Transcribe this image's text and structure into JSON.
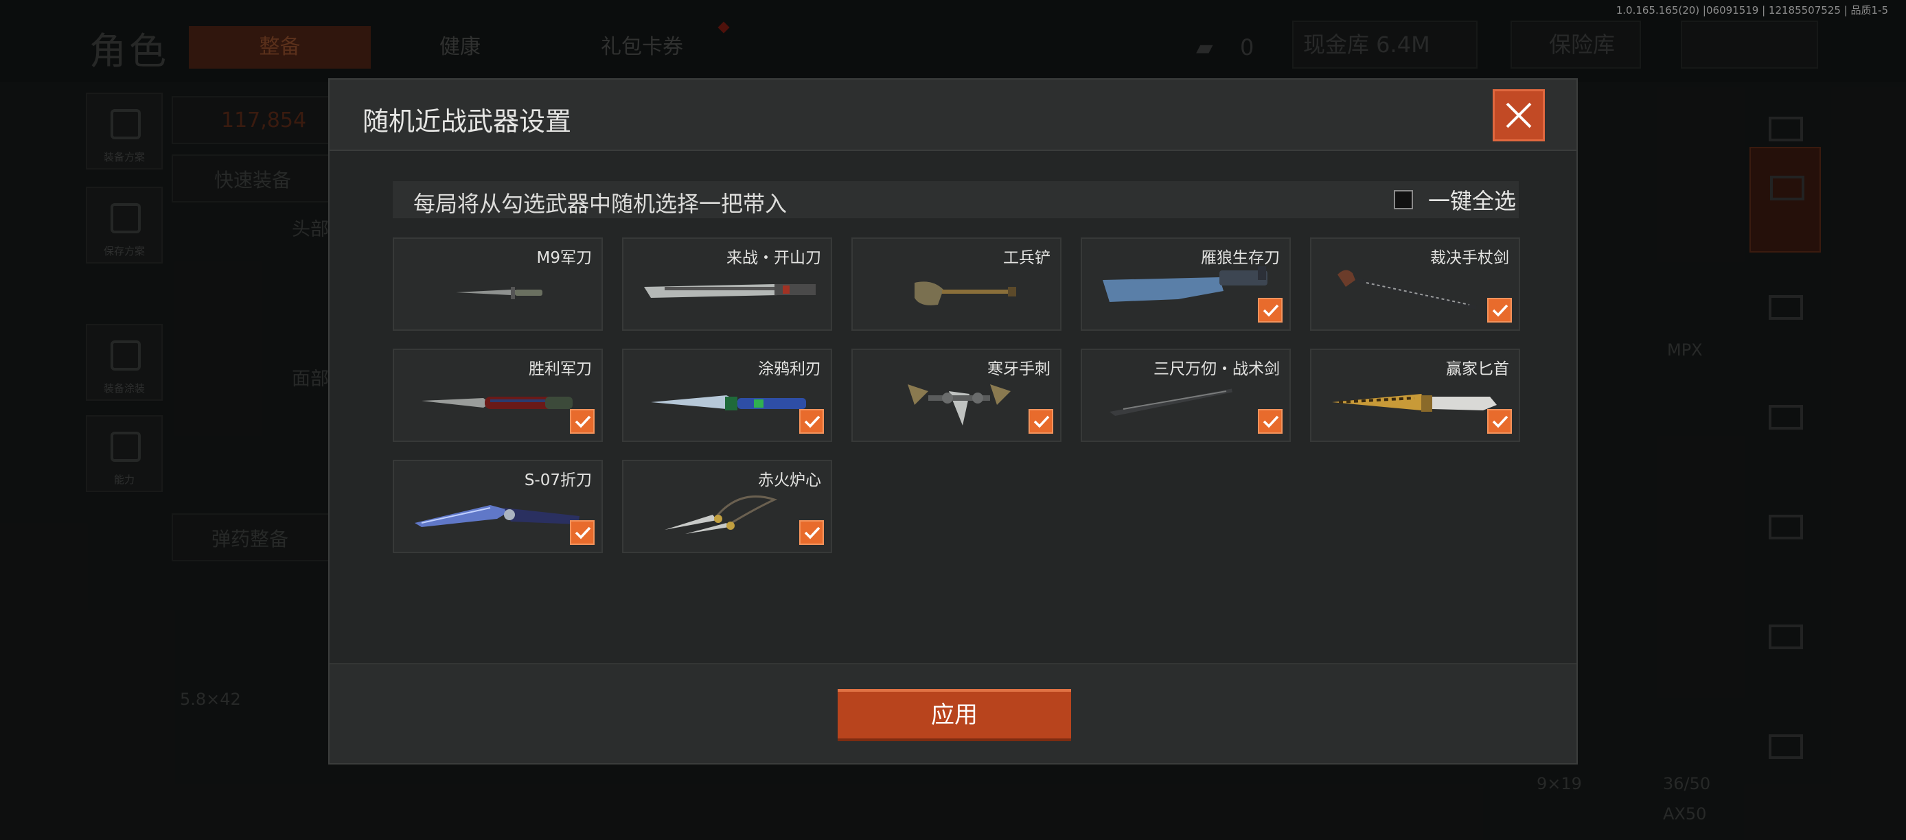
{
  "background": {
    "version": "1.0.165.165(20) |06091519 | 12185507525 | 品质1-5",
    "page_title": "角色",
    "tabs": [
      "整备",
      "健康",
      "礼包卡券"
    ],
    "currency_value": "0",
    "cash_label": "现金库 6.4M",
    "vault_label": "保险库",
    "value_label": "117,854",
    "quick_equip": "快速装备",
    "head_label": "头部",
    "face_label": "面部",
    "ammo_label": "弹药整备",
    "ammo_caliber": "5.8×42",
    "left_side": [
      "装备方案",
      "保存方案",
      "装备涂装",
      "能力"
    ],
    "mpx_label": "MPX",
    "ammo_caliber_2": "9×19",
    "ammo_count": "36/50",
    "ax_label": "AX50"
  },
  "modal": {
    "title": "随机近战武器设置",
    "hint": "每局将从勾选武器中随机选择一把带入",
    "select_all_label": "一键全选",
    "select_all_checked": false,
    "apply_label": "应用"
  },
  "weapons": [
    {
      "name": "M9军刀",
      "checked": false,
      "icon": "combat-knife-icon"
    },
    {
      "name": "来战・开山刀",
      "checked": false,
      "icon": "machete-icon"
    },
    {
      "name": "工兵铲",
      "checked": false,
      "icon": "shovel-icon"
    },
    {
      "name": "雁狼生存刀",
      "checked": true,
      "icon": "survival-knife-icon"
    },
    {
      "name": "裁决手杖剑",
      "checked": true,
      "icon": "cane-sword-icon"
    },
    {
      "name": "胜利军刀",
      "checked": true,
      "icon": "victory-knife-icon"
    },
    {
      "name": "涂鸦利刃",
      "checked": true,
      "icon": "graffiti-blade-icon"
    },
    {
      "name": "寒牙手刺",
      "checked": true,
      "icon": "hand-claw-icon"
    },
    {
      "name": "三尺万仞・战术剑",
      "checked": true,
      "icon": "tactical-sword-icon"
    },
    {
      "name": "赢家匕首",
      "checked": true,
      "icon": "gold-dagger-icon"
    },
    {
      "name": "S-07折刀",
      "checked": true,
      "icon": "folding-knife-icon"
    },
    {
      "name": "赤火炉心",
      "checked": true,
      "icon": "twin-kunai-icon"
    }
  ],
  "colors": {
    "accent": "#e86b2c",
    "close_bg": "#c24a25",
    "apply_bg": "#b8441d",
    "modal_bg": "#242626"
  }
}
